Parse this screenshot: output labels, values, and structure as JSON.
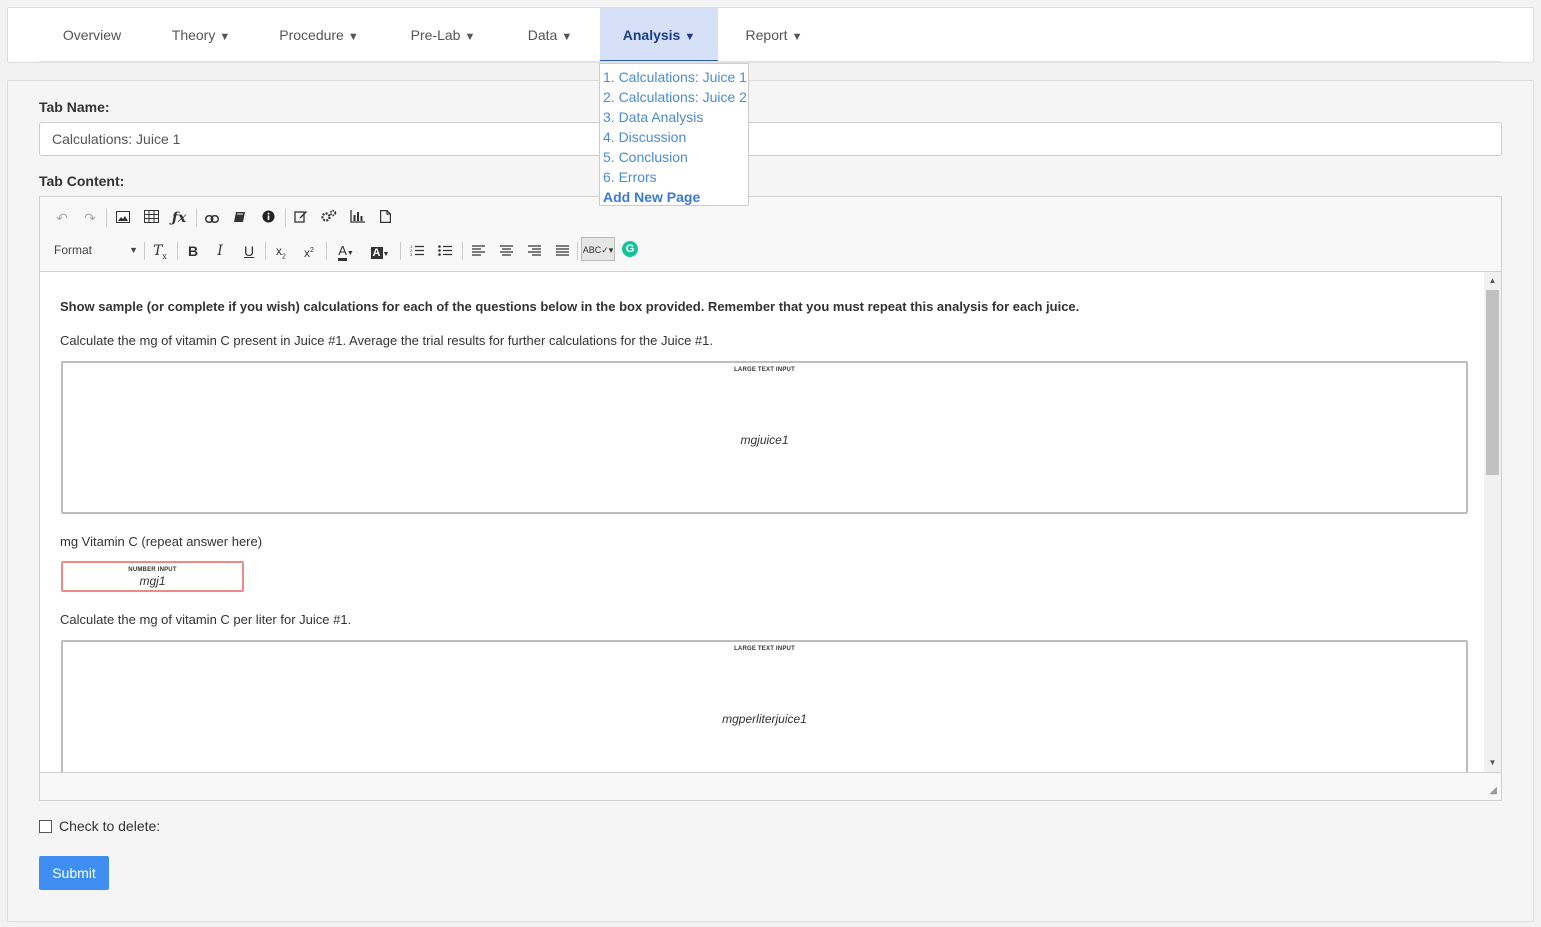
{
  "nav": {
    "tabs": [
      {
        "label": "Overview",
        "arrow": ""
      },
      {
        "label": "Theory",
        "arrow": "▼"
      },
      {
        "label": "Procedure",
        "arrow": "▼"
      },
      {
        "label": "Pre-Lab",
        "arrow": "▼"
      },
      {
        "label": "Data",
        "arrow": "▼"
      },
      {
        "label": "Analysis",
        "arrow": "▼"
      },
      {
        "label": "Report",
        "arrow": "▼"
      }
    ],
    "active": "Analysis"
  },
  "dropdown": {
    "items": [
      "1. Calculations: Juice 1",
      "2. Calculations: Juice 2",
      "3. Data Analysis",
      "4. Discussion",
      "5. Conclusion",
      "6. Errors"
    ],
    "add_label": "Add New Page"
  },
  "form": {
    "tab_name_label": "Tab Name:",
    "tab_name_value": "Calculations: Juice 1",
    "tab_content_label": "Tab Content:",
    "delete_label": "Check to delete:",
    "submit_label": "Submit"
  },
  "toolbar": {
    "format_label": "Format",
    "spell_label": "ABC"
  },
  "content": {
    "intro": "Show sample (or complete if you wish) calculations for each of the questions below in the box provided. Remember that you must repeat this analysis for each juice.",
    "q1": "Calculate the mg of vitamin C present in Juice #1.  Average the trial results for further calculations for the Juice #1.",
    "box1_tag": "LARGE TEXT INPUT",
    "box1_var": "mgjuice1",
    "q2": "mg Vitamin C (repeat answer here)",
    "num_tag": "NUMBER INPUT",
    "num_var": "mgj1",
    "q3": "Calculate the mg of vitamin C per liter for Juice #1.",
    "box2_tag": "LARGE TEXT INPUT",
    "box2_var": "mgperliterjuice1"
  }
}
